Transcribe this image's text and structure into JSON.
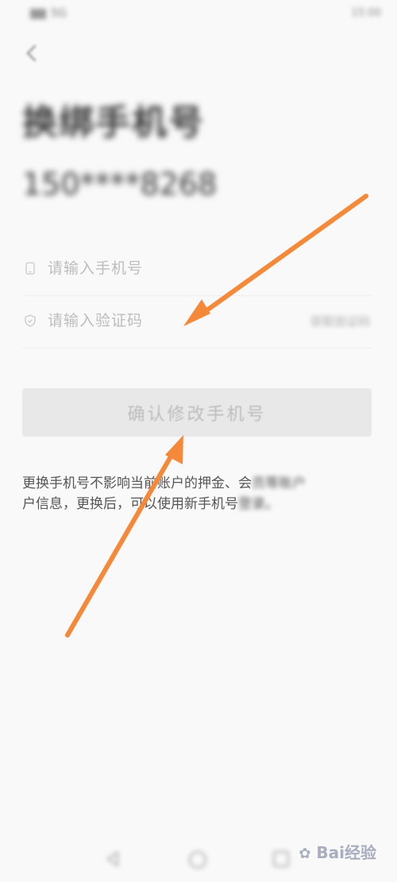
{
  "status_bar": {
    "left_text": "5G",
    "right_text": "15:00"
  },
  "page": {
    "title": "换绑手机号",
    "masked_phone": "150****8268"
  },
  "form": {
    "phone_placeholder": "请输入手机号",
    "code_placeholder": "请输入验证码",
    "get_code_label": "获取验证码",
    "confirm_label": "确认修改手机号"
  },
  "notice": {
    "part_clear": "更换手机号不影响当前账户的押金、会",
    "part_blur1": "员等账户",
    "line2_clear": "户信息，更换后，可以使用新手机号",
    "part_blur2": "登录。"
  },
  "watermark": {
    "text": "Bai经验"
  },
  "colors": {
    "background": "#f9f9f9",
    "annotation_arrow": "#f5893a",
    "button_disabled": "#e8e8e8",
    "placeholder": "#bdbdbd"
  },
  "icons": {
    "back": "chevron-left-icon",
    "phone": "phone-icon",
    "code": "shield-icon",
    "nav_back": "triangle-back-icon",
    "nav_home": "circle-home-icon",
    "nav_recent": "square-recent-icon"
  }
}
